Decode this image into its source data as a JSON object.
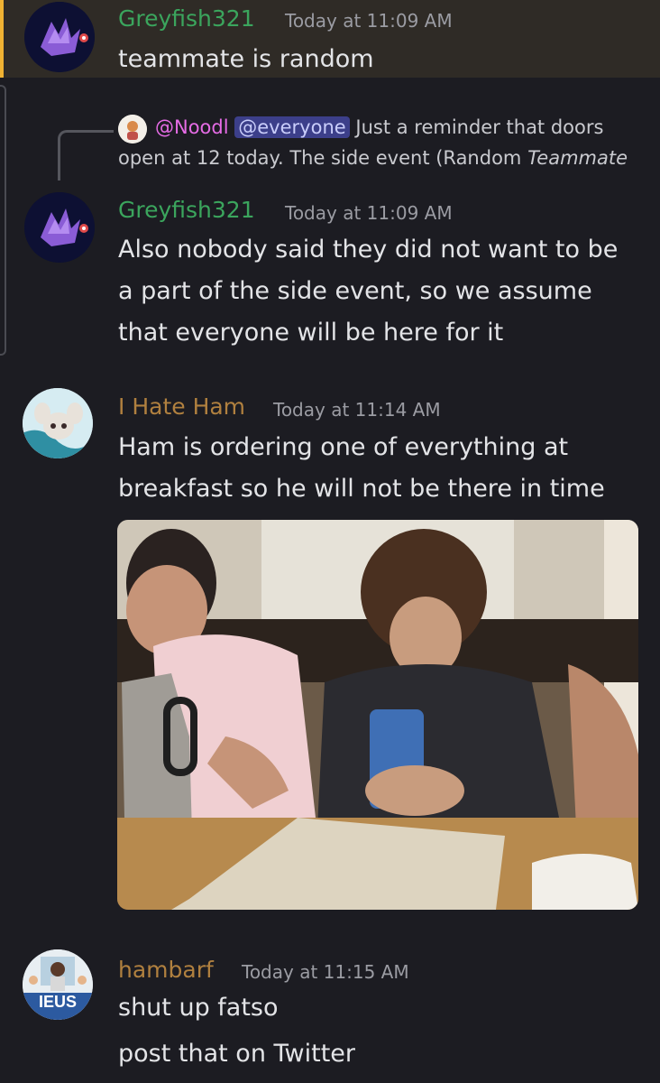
{
  "colors": {
    "background": "#1c1c22",
    "highlight": "#2f2b26",
    "highlight_bar": "#f0b232",
    "greyfish_name": "#3ba55d",
    "hate_ham_name": "#b0803f",
    "hambarf_name": "#b0803f",
    "noodl_name": "#e66ce6",
    "mention_bg": "#3c3f8a"
  },
  "messages": [
    {
      "author": "Greyfish321",
      "timestamp": "Today at 11:09 AM",
      "lines": [
        "teammate is random"
      ],
      "avatar_icon": "purple-dragon-avatar-icon"
    },
    {
      "reply": {
        "author": "@Noodl",
        "mention": "@everyone",
        "text_line1": "Just a reminder that doors",
        "text_line2_plain": "open at 12 today.  The side event (Random ",
        "text_line2_italic": "Teammate"
      },
      "author": "Greyfish321",
      "timestamp": "Today at 11:09 AM",
      "lines": [
        "Also nobody said they did not want to be",
        "a part of the side event, so we assume",
        "that everyone will be here for it"
      ],
      "avatar_icon": "purple-dragon-avatar-icon"
    },
    {
      "author": "I Hate Ham",
      "timestamp": "Today at 11:14 AM",
      "lines": [
        "Ham is ordering one of everything at",
        "breakfast so he will not be there in time"
      ],
      "avatar_icon": "minccino-avatar-icon",
      "attachment": "restaurant-photo"
    },
    {
      "author": "hambarf",
      "timestamp": "Today at 11:15 AM",
      "lines": [
        "shut up fatso",
        "post that on Twitter"
      ],
      "avatar_icon": "ieus-avatar-icon",
      "avatar_text": "IEUS"
    }
  ]
}
